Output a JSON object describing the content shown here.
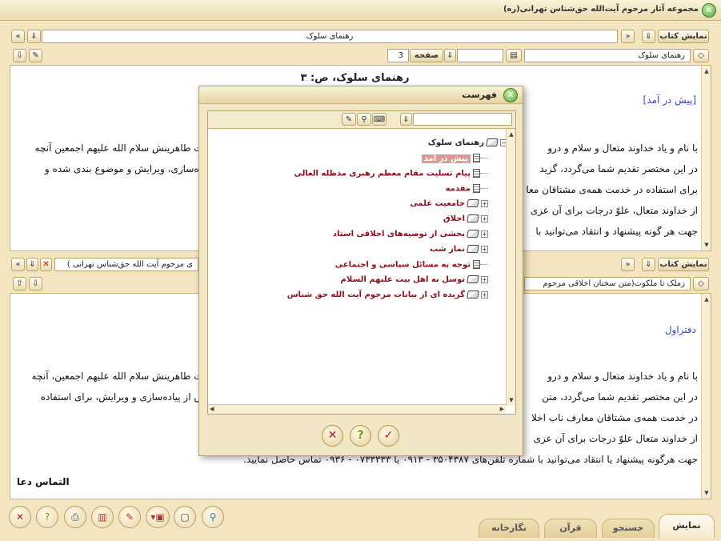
{
  "window": {
    "title": "مجموعه آثار مرحوم آیت‌الله حق‌شناس تهرانی(ره)"
  },
  "top_pane": {
    "show_book_label": "نمایش کتاب",
    "book_title": "رهنمای سلوک",
    "book_field": "رهنمای سلوک",
    "page_label": "صفحه",
    "page_value": "3",
    "heading": "رهنمای سلوک، ص: ۳",
    "section_link": "[پیش در آمد]",
    "lines": [
      "با نام و یاد خداوند متعال و سلام و درو",
      "در این مختصر تقدیم شما می‌گردد، گزید",
      "برای استفاده در خدمت همه‌ی مشتاقان معا",
      "از خداوند متعال، علوّ درجات برای آن عزی",
      "جهت هر گونه پیشنهاد و انتقاد می‌توانید با"
    ],
    "lines_right": [
      "بیت طاهرینش سلام الله علیهم اجمعین آنچه",
      "یاده‌سازی، ویرایش و موضوع بندی شده و",
      "",
      "",
      ""
    ]
  },
  "bottom_pane": {
    "show_book_label": "نمایش کتاب",
    "book_title": "ی مرحوم آیت الله حق‌شناس تهرانی )",
    "book_field": "زملک تا ملکوت(متن سخنان اخلاقی مرحوم",
    "section_title": "دفتراول",
    "lines": [
      "با نام و یاد خداوند متعال و سلام و درو",
      "در این مختصر تقدیم شما می‌گردد، متن",
      "در خدمت همه‌ی مشتاقان معارف ناب اخلا",
      "از خداوند متعال علوّ درجات برای آن عزی",
      "جهت هرگونه پیشنهاد یا انتقاد می‌توانید با شماره تلفن‌های ۳۵۰۴۳۸۷ - ۰۹۱۳ یا ۰۷۳۳۳۳۳ - ۰۹۳۶ تماس حاصل نمایید."
    ],
    "lines_right": [
      "بیت طاهرینش سلام الله علیهم اجمعین، آنچه",
      "پس از پیاده‌سازی و ویرایش، برای استفاده",
      "",
      "",
      ""
    ],
    "closing": "التماس دعا"
  },
  "dialog": {
    "title": "فهرست",
    "root": "رهنمای سلوک",
    "items": [
      {
        "label": "پیش در آمد",
        "kind": "doc",
        "selected": true
      },
      {
        "label": "پیام تسلیت مقام معظم رهبری مدظله العالی",
        "kind": "doc",
        "selected": false
      },
      {
        "label": "مقدمه",
        "kind": "doc",
        "selected": false
      },
      {
        "label": "جامعیت علمی",
        "kind": "book",
        "selected": false
      },
      {
        "label": "اخلاق",
        "kind": "book",
        "selected": false
      },
      {
        "label": "بخشی از توصیه‌های اخلاقی استاد",
        "kind": "book",
        "selected": false
      },
      {
        "label": "نماز شب",
        "kind": "book",
        "selected": false
      },
      {
        "label": "توجه به مسائل سیاسی و اجتماعی",
        "kind": "doc",
        "selected": false
      },
      {
        "label": "توسل به اهل بیت علیهم السلام",
        "kind": "book",
        "selected": false
      },
      {
        "label": "گزیده ای از بیانات مرحوم آیت الله حق شناس",
        "kind": "book",
        "selected": false
      }
    ]
  },
  "tabs": [
    "نمایش",
    "جستجو",
    "قرآن",
    "نگارخانه"
  ],
  "colors": {
    "background": "#f3e5bf",
    "tree_link": "#8a0f1d",
    "selected": "#d99a9a",
    "section_link": "#3344cc"
  }
}
